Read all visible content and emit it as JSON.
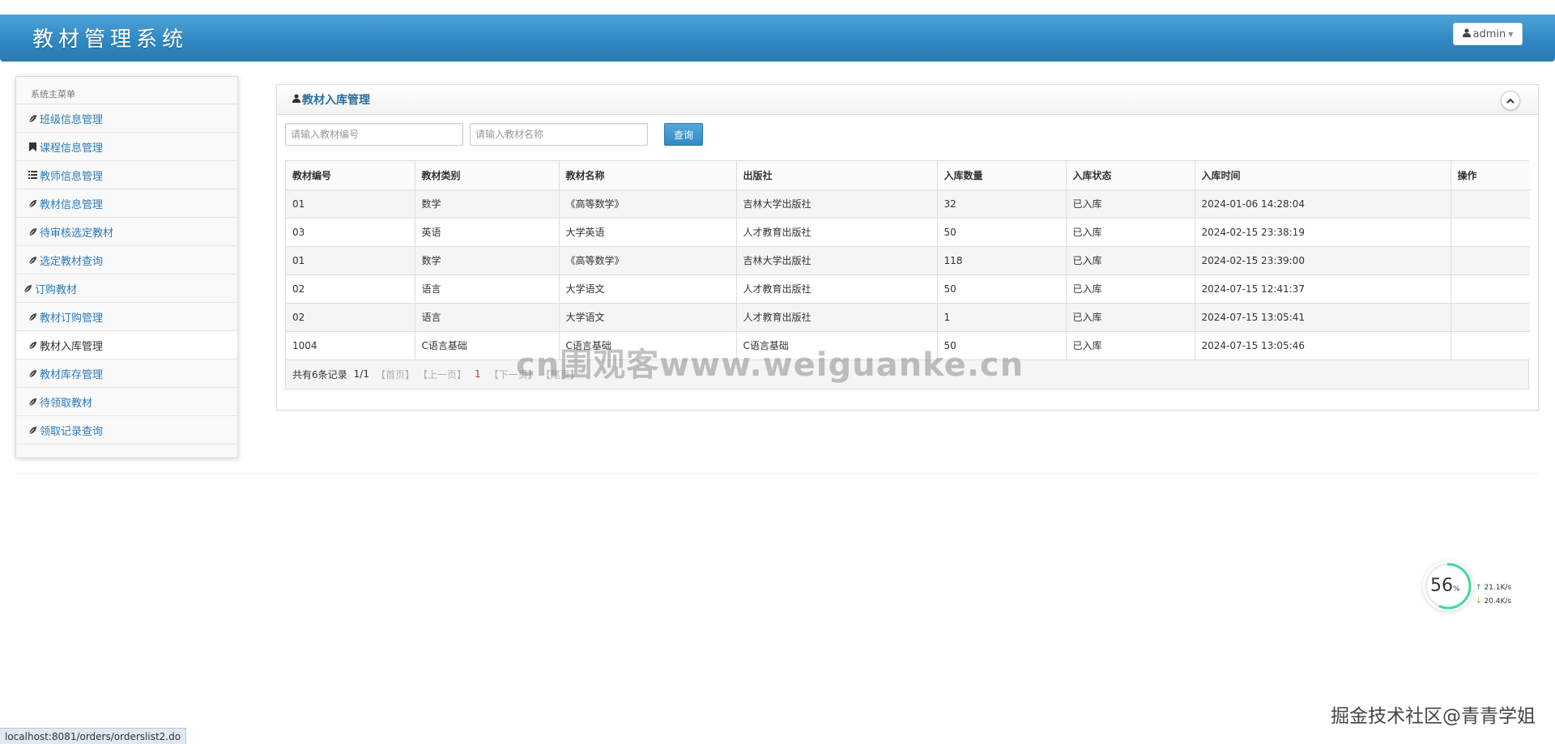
{
  "app": {
    "title": "教材管理系统",
    "user": "admin"
  },
  "sidebar": {
    "header": "系统主菜单",
    "items": [
      {
        "label": "班级信息管理",
        "icon": "leaf-icon"
      },
      {
        "label": "课程信息管理",
        "icon": "bookmark-icon"
      },
      {
        "label": "教师信息管理",
        "icon": "list-icon"
      },
      {
        "label": "教材信息管理",
        "icon": "leaf-icon"
      },
      {
        "label": "待审核选定教材",
        "icon": "leaf-icon"
      },
      {
        "label": "选定教材查询",
        "icon": "leaf-icon"
      },
      {
        "label": "订购教材",
        "icon": "leaf-icon"
      },
      {
        "label": "教材订购管理",
        "icon": "leaf-icon"
      },
      {
        "label": "教材入库管理",
        "icon": "leaf-icon"
      },
      {
        "label": "教材库存管理",
        "icon": "leaf-icon"
      },
      {
        "label": "待领取教材",
        "icon": "leaf-icon"
      },
      {
        "label": "领取记录查询",
        "icon": "leaf-icon"
      }
    ]
  },
  "panel": {
    "title": "教材入库管理",
    "search": {
      "code_placeholder": "请输入教材编号",
      "name_placeholder": "请输入教材名称",
      "query_label": "查询"
    },
    "table": {
      "columns": [
        "教材编号",
        "教材类别",
        "教材名称",
        "出版社",
        "入库数量",
        "入库状态",
        "入库时间",
        "操作"
      ],
      "rows": [
        [
          "01",
          "数学",
          "《高等数学》",
          "吉林大学出版社",
          "32",
          "已入库",
          "2024-01-06 14:28:04",
          ""
        ],
        [
          "03",
          "英语",
          "大学英语",
          "人才教育出版社",
          "50",
          "已入库",
          "2024-02-15 23:38:19",
          ""
        ],
        [
          "01",
          "数学",
          "《高等数学》",
          "吉林大学出版社",
          "118",
          "已入库",
          "2024-02-15 23:39:00",
          ""
        ],
        [
          "02",
          "语言",
          "大学语文",
          "人才教育出版社",
          "50",
          "已入库",
          "2024-07-15 12:41:37",
          ""
        ],
        [
          "02",
          "语言",
          "大学语文",
          "人才教育出版社",
          "1",
          "已入库",
          "2024-07-15 13:05:41",
          ""
        ],
        [
          "1004",
          "C语言基础",
          "C语言基础",
          "C语言基础",
          "50",
          "已入库",
          "2024-07-15 13:05:46",
          ""
        ]
      ]
    },
    "pager": {
      "total": "共有6条记录",
      "page": "1/1",
      "first": "【首页】",
      "prev": "【上一页】",
      "current": "1",
      "next": "【下一页】",
      "last": "【尾页】"
    }
  },
  "watermark": {
    "center": "cn围观客www.weiguanke.cn",
    "bottom_right": "掘金技术社区@青青学姐"
  },
  "network": {
    "percent": "56",
    "percent_unit": "%",
    "upload": "21.1",
    "download": "20.4",
    "unit": "K/s",
    "percent_value": 56
  },
  "status_url": "localhost:8081/orders/orderslist2.do"
}
